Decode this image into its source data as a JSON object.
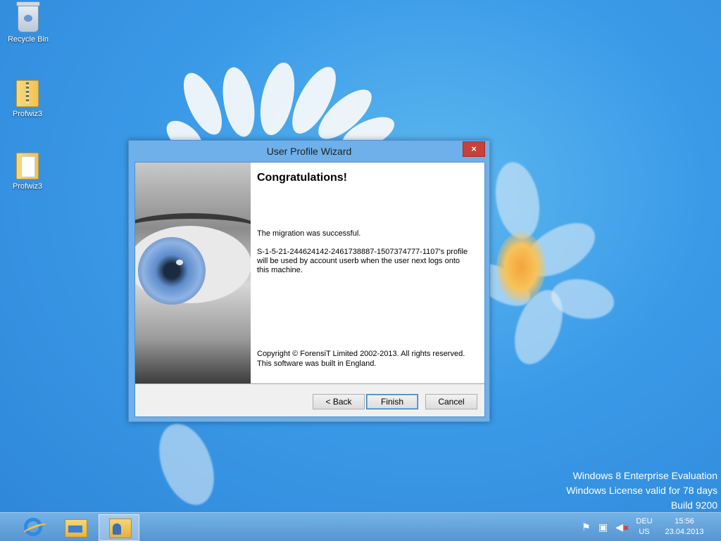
{
  "desktop": {
    "icons": [
      {
        "label": "Recycle Bin",
        "icon": "recycle-bin-icon"
      },
      {
        "label": "Profwiz3",
        "icon": "zip-folder-icon"
      },
      {
        "label": "Profwiz3",
        "icon": "folder-icon"
      }
    ],
    "watermark": {
      "line1": "Windows 8 Enterprise Evaluation",
      "line2": "Windows License valid for 78 days",
      "line3": "Build 9200"
    }
  },
  "dialog": {
    "title": "User Profile Wizard",
    "close_label": "×",
    "heading": "Congratulations!",
    "message1": "The migration was successful.",
    "message2": "S-1-5-21-244624142-2461738887-1507374777-1107's profile will be used by account userb when the user next logs onto this machine.",
    "copyright1": "Copyright © ForensiT Limited 2002-2013. All rights reserved.",
    "copyright2": "This software was built in England.",
    "buttons": {
      "back": "< Back",
      "finish": "Finish",
      "cancel": "Cancel"
    }
  },
  "taskbar": {
    "apps": [
      {
        "name": "Internet Explorer",
        "icon": "internet-explorer-icon"
      },
      {
        "name": "File Explorer",
        "icon": "file-explorer-icon"
      },
      {
        "name": "User Profile Wizard",
        "icon": "profile-wizard-icon",
        "active": true
      }
    ],
    "tray": {
      "flag_icon": "action-center-flag-icon",
      "network_icon": "network-icon",
      "volume_icon": "volume-muted-icon",
      "lang_top": "DEU",
      "lang_bottom": "US",
      "time": "15:56",
      "date": "23.04.2013"
    }
  }
}
